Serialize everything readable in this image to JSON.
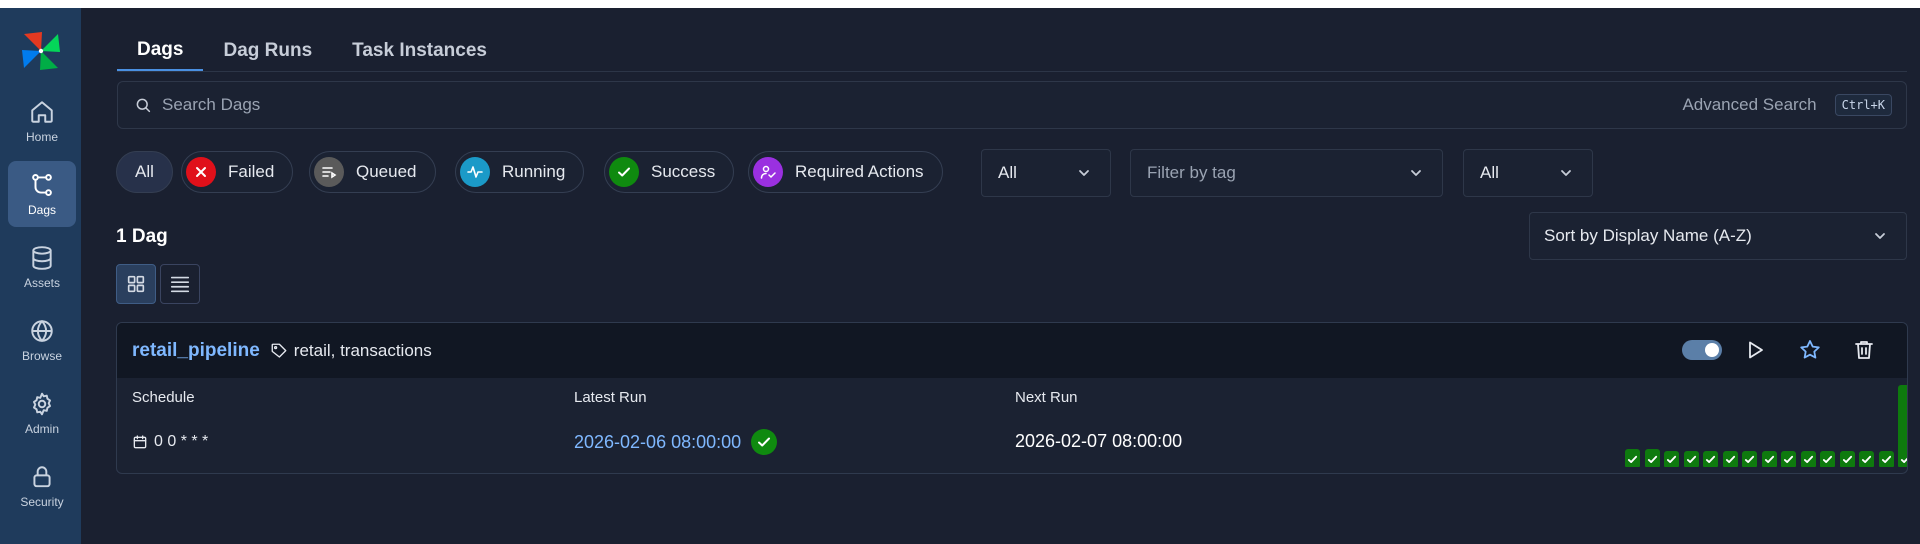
{
  "sidebar": {
    "items": [
      {
        "label": "Home",
        "icon": "home-icon"
      },
      {
        "label": "Dags",
        "icon": "dags-icon"
      },
      {
        "label": "Assets",
        "icon": "database-icon"
      },
      {
        "label": "Browse",
        "icon": "globe-icon"
      },
      {
        "label": "Admin",
        "icon": "gear-icon"
      },
      {
        "label": "Security",
        "icon": "lock-icon"
      }
    ],
    "active": "Dags"
  },
  "tabs": [
    {
      "label": "Dags"
    },
    {
      "label": "Dag Runs"
    },
    {
      "label": "Task Instances"
    }
  ],
  "search": {
    "placeholder": "Search Dags",
    "advanced_label": "Advanced Search",
    "shortcut": "Ctrl+K"
  },
  "filters": {
    "all_label": "All",
    "failed_label": "Failed",
    "queued_label": "Queued",
    "running_label": "Running",
    "success_label": "Success",
    "required_label": "Required Actions"
  },
  "selects": {
    "status_value": "All",
    "tag_placeholder": "Filter by tag",
    "owner_value": "All"
  },
  "count_label": "1 Dag",
  "sort_label": "Sort by Display Name (A-Z)",
  "colors": {
    "sidebar_bg": "#1f3b5c",
    "accent_link": "#7fb8ff",
    "success": "#0f8a0f",
    "failed": "#e0101a",
    "running": "#1b9ac8",
    "required": "#9a30e0",
    "queued": "#5a5a5a"
  },
  "dag": {
    "name": "retail_pipeline",
    "tags": "retail, transactions",
    "paused": false,
    "schedule_label": "Schedule",
    "schedule": "0 0 * * *",
    "latest_label": "Latest Run",
    "latest_run": "2026-02-06 08:00:00",
    "latest_state": "success",
    "next_label": "Next Run",
    "next_run": "2026-02-07 08:00:00",
    "recent_runs": [
      {
        "state": "success",
        "relative_duration": 0.22
      },
      {
        "state": "success",
        "relative_duration": 0.22
      },
      {
        "state": "success",
        "relative_duration": 0.2
      },
      {
        "state": "success",
        "relative_duration": 0.18
      },
      {
        "state": "success",
        "relative_duration": 0.18
      },
      {
        "state": "success",
        "relative_duration": 0.18
      },
      {
        "state": "success",
        "relative_duration": 0.18
      },
      {
        "state": "success",
        "relative_duration": 0.2
      },
      {
        "state": "success",
        "relative_duration": 0.2
      },
      {
        "state": "success",
        "relative_duration": 0.2
      },
      {
        "state": "success",
        "relative_duration": 0.18
      },
      {
        "state": "success",
        "relative_duration": 0.18
      },
      {
        "state": "success",
        "relative_duration": 0.2
      },
      {
        "state": "success",
        "relative_duration": 0.18
      },
      {
        "state": "success",
        "relative_duration": 1.0
      }
    ]
  }
}
